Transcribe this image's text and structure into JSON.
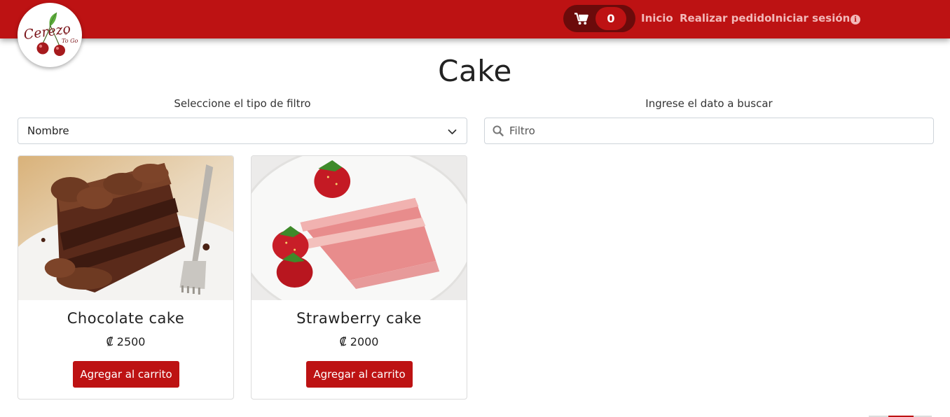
{
  "brand": {
    "name": "Cerezo To Go",
    "accent": "#bd1213"
  },
  "nav": {
    "cart_count": "0",
    "links": [
      "Inicio",
      "Realizar pedido",
      "Iniciar sesión"
    ]
  },
  "page": {
    "title": "Cake"
  },
  "filters": {
    "type_label": "Seleccione el tipo de filtro",
    "type_selected": "Nombre",
    "search_label": "Ingrese el dato a buscar",
    "search_placeholder": "Filtro"
  },
  "products": [
    {
      "name": "Chocolate cake",
      "price": "₡ 2500",
      "button": "Agregar al carrito"
    },
    {
      "name": "Strawberry cake",
      "price": "₡ 2000",
      "button": "Agregar al carrito"
    }
  ]
}
